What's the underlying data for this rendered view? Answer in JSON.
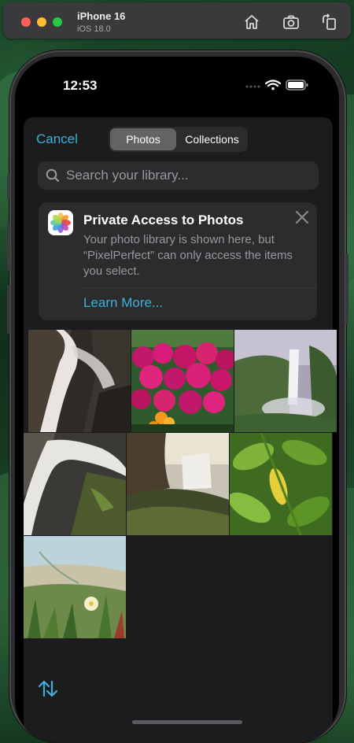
{
  "simulator": {
    "device_name": "iPhone 16",
    "os_version": "iOS 18.0",
    "buttons": [
      "home-icon",
      "screenshot-icon",
      "rotate-icon"
    ]
  },
  "status_bar": {
    "time": "12:53",
    "icons": [
      "wifi-icon",
      "battery-icon"
    ]
  },
  "picker": {
    "cancel_label": "Cancel",
    "tabs": [
      {
        "label": "Photos",
        "selected": true
      },
      {
        "label": "Collections",
        "selected": false
      }
    ],
    "search": {
      "placeholder": "Search your library...",
      "value": ""
    },
    "banner": {
      "title": "Private Access to Photos",
      "body": "Your photo library is shown here, but “PixelPerfect” can only access the items you select.",
      "link": "Learn More...",
      "icon": "photos-app-icon"
    },
    "photos": [
      {
        "subject": "waterfall over dark rocks"
      },
      {
        "subject": "magenta flowers"
      },
      {
        "subject": "waterfall on cliff"
      },
      {
        "subject": "long exposure waterfall"
      },
      {
        "subject": "waterfall over mossy rocks"
      },
      {
        "subject": "green leaves"
      },
      {
        "subject": "grass and white flower"
      }
    ],
    "sort_icon": "sort-arrows-icon"
  },
  "colors": {
    "accent": "#3fb0d6",
    "sheet_background": "#1c1c1e",
    "segment_selected": "#636366"
  }
}
